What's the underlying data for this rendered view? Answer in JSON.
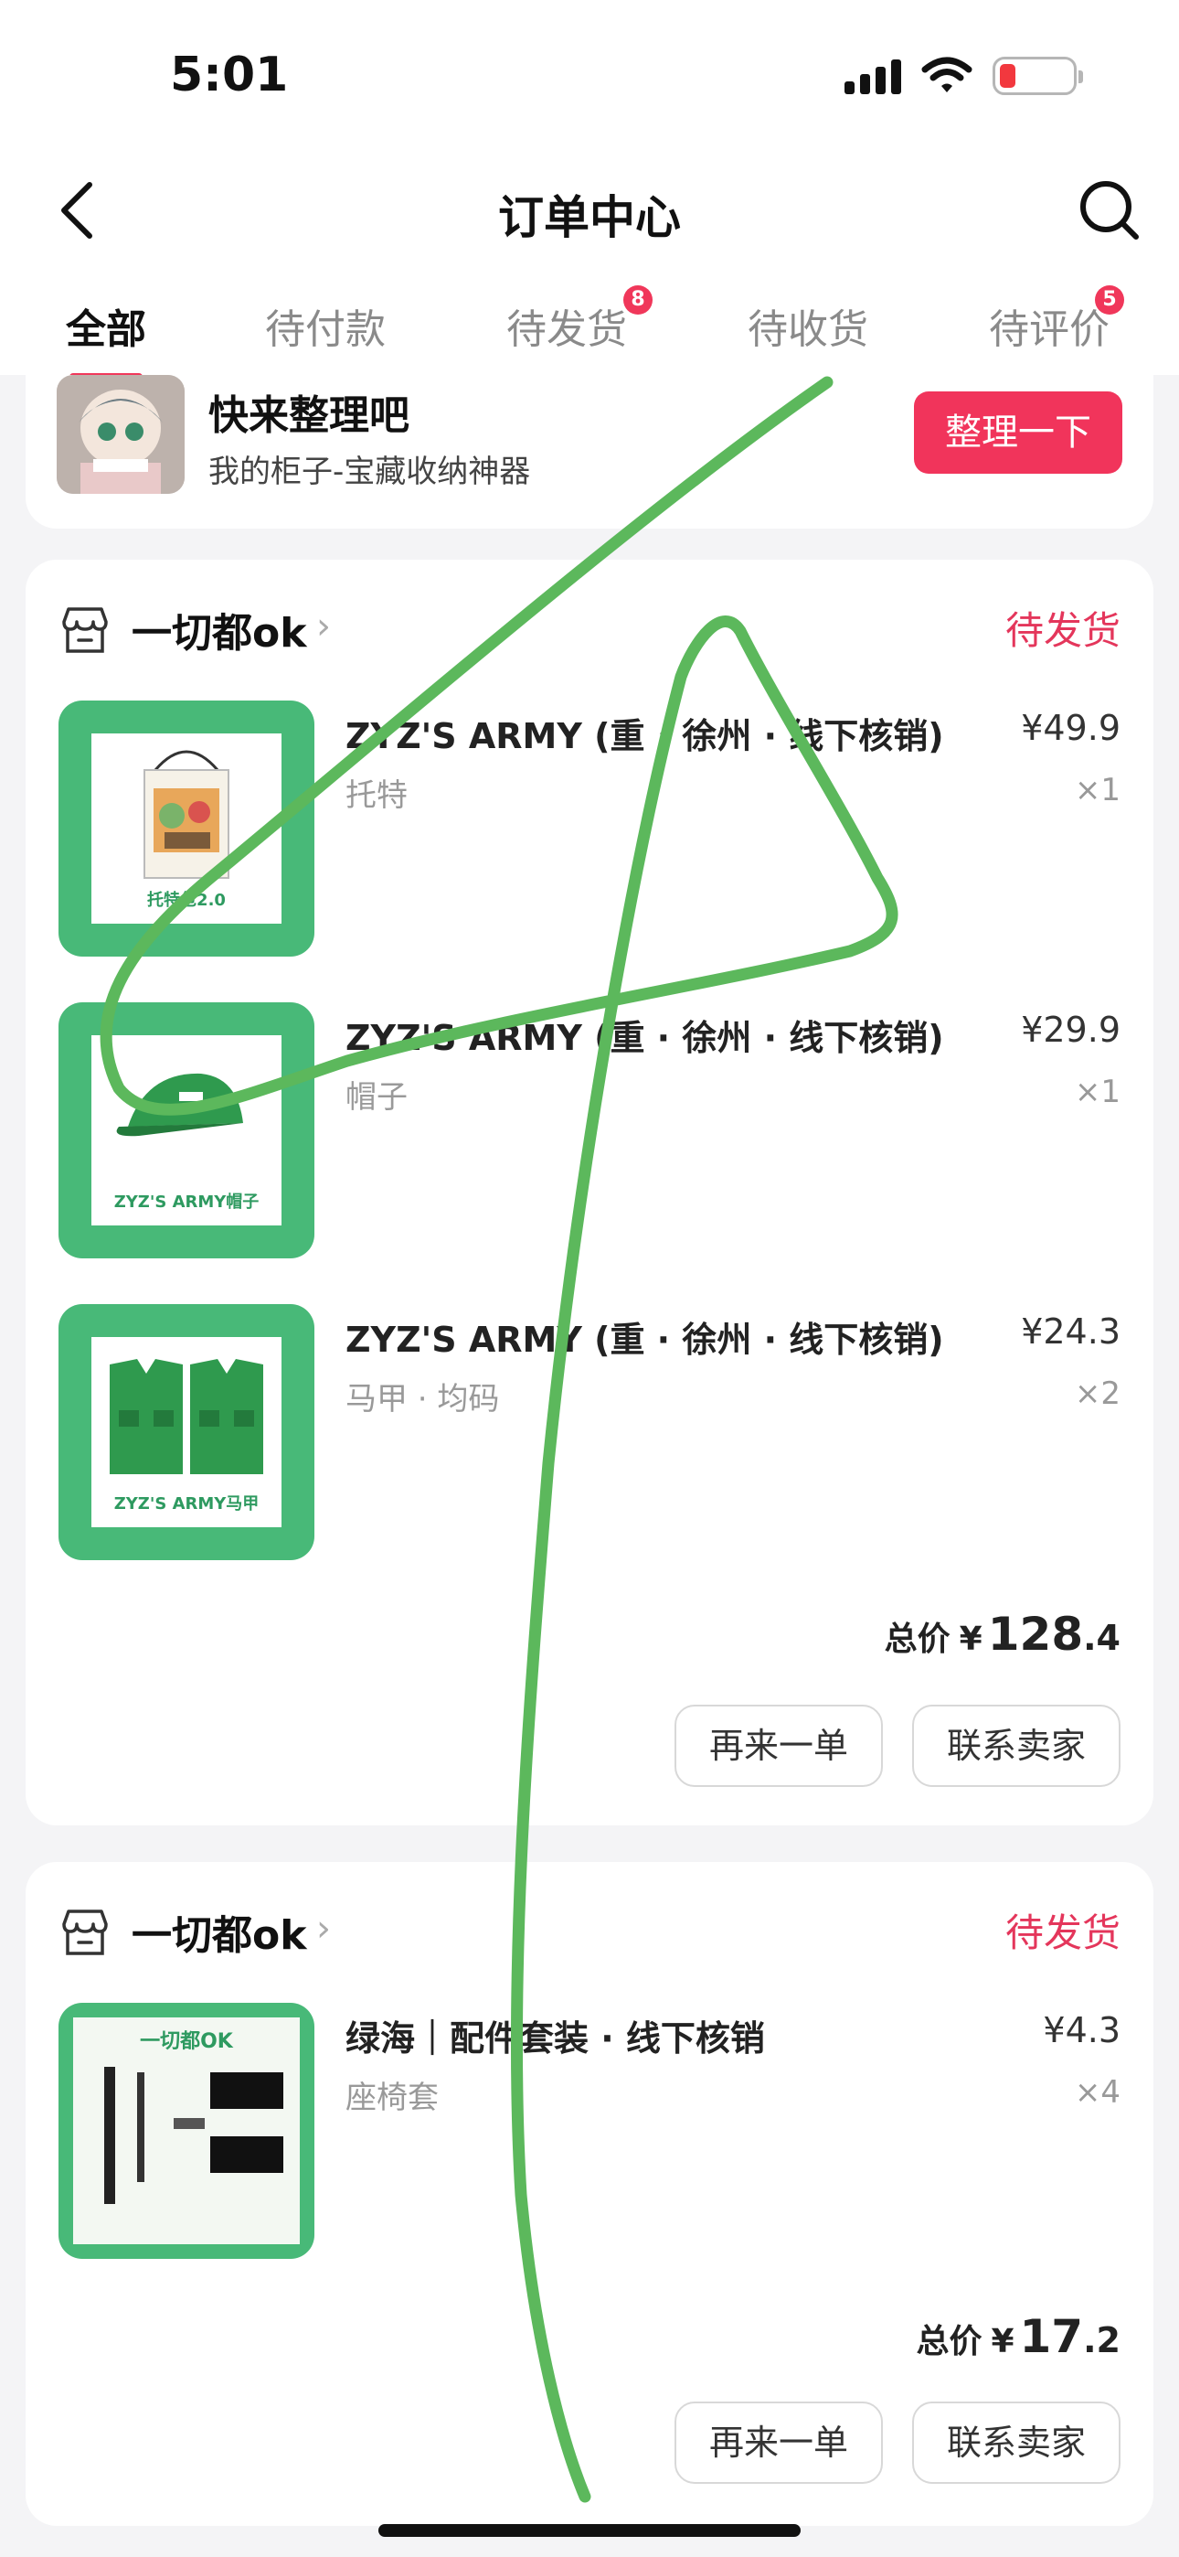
{
  "status_bar": {
    "time": "5:01"
  },
  "nav": {
    "title": "订单中心"
  },
  "tabs": [
    {
      "label": "全部",
      "badge": ""
    },
    {
      "label": "待付款",
      "badge": ""
    },
    {
      "label": "待发货",
      "badge": "8"
    },
    {
      "label": "待收货",
      "badge": ""
    },
    {
      "label": "待评价",
      "badge": "5"
    }
  ],
  "organize": {
    "title": "快来整理吧",
    "subtitle": "我的柜子-宝藏收纳神器",
    "button": "整理一下"
  },
  "orders": [
    {
      "shop": "一切都ok",
      "status": "待发货",
      "items": [
        {
          "title": "ZYZ'S ARMY (重 · 徐州 · 线下核销)",
          "spec": "托特",
          "price": "¥49.9",
          "qty": "×1",
          "image_caption": "托特包2.0"
        },
        {
          "title": "ZYZ'S ARMY (重 · 徐州 · 线下核销)",
          "spec": "帽子",
          "price": "¥29.9",
          "qty": "×1",
          "image_caption": "ZYZ'S ARMY帽子"
        },
        {
          "title": "ZYZ'S ARMY (重 · 徐州 · 线下核销)",
          "spec": "马甲 · 均码",
          "price": "¥24.3",
          "qty": "×2",
          "image_caption": "ZYZ'S ARMY马甲"
        }
      ],
      "total_label": "总价",
      "total_symbol": "¥",
      "total_int": "128",
      "total_dec": ".4",
      "reorder": "再来一单",
      "contact": "联系卖家"
    },
    {
      "shop": "一切都ok",
      "status": "待发货",
      "items": [
        {
          "title": "绿海｜配件套装 · 线下核销",
          "spec": "座椅套",
          "price": "¥4.3",
          "qty": "×4",
          "image_caption": "一切都OK"
        }
      ],
      "total_label": "总价",
      "total_symbol": "¥",
      "total_int": "17",
      "total_dec": ".2",
      "reorder": "再来一单",
      "contact": "联系卖家"
    }
  ],
  "colors": {
    "accent": "#f0375a",
    "status": "#e4365b",
    "product_green": "#48b978",
    "scribble": "#5cb85c"
  }
}
